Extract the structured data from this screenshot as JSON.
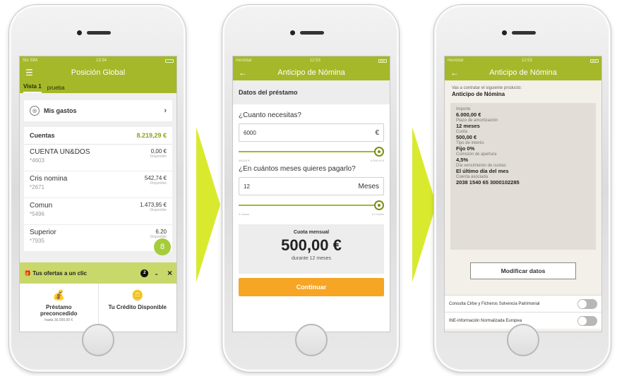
{
  "phone1": {
    "status": {
      "carrier": "Sin SIM",
      "time": "13:34"
    },
    "nav": {
      "title": "Posición Global",
      "menu_icon": "hamburger-icon"
    },
    "tabs": [
      "Vista 1",
      "prueba"
    ],
    "gastos": {
      "label": "Mis gastos"
    },
    "cuentas": {
      "title": "Cuentas",
      "total": "8.219,29 €",
      "rows": [
        {
          "name": "CUENTA UN&DOS",
          "number": "*4603",
          "amount": "0,00 €",
          "status": "Disponible"
        },
        {
          "name": "Cris nomina",
          "number": "*2671",
          "amount": "542,74 €",
          "status": "Disponible"
        },
        {
          "name": "Comun",
          "number": "*5496",
          "amount": "1.473,95 €",
          "status": "Disponible"
        },
        {
          "name": "Superior",
          "number": "*7935",
          "amount": "6.20",
          "status": "Disponible"
        }
      ]
    },
    "ofertas": {
      "label": "Tus ofertas a un clic",
      "count": "2"
    },
    "products": [
      {
        "label": "Préstamo preconcedido",
        "sub": "hasta 30.000,00 €"
      },
      {
        "label": "Tu Crédito Disponible",
        "sub": ""
      }
    ]
  },
  "phone2": {
    "status": {
      "carrier": "movistar",
      "time": "12:53"
    },
    "nav": {
      "title": "Anticipo de Nómina"
    },
    "section": "Datos del préstamo",
    "amount_question": "¿Cuanto necesitas?",
    "amount_value": "6000",
    "amount_unit": "€",
    "amount_range": {
      "min": "450,00 €",
      "max": "6.000,00 €"
    },
    "amount_level": 1.0,
    "months_question": "¿En cuántos meses quieres pagarlo?",
    "months_value": "12",
    "months_unit": "Meses",
    "months_range": {
      "min": "3 meses",
      "max": "12 meses"
    },
    "months_level": 1.0,
    "cuota": {
      "label": "Cuota mensual",
      "value": "500,00 €",
      "duration": "durante 12 meses"
    },
    "cta": "Continuar"
  },
  "phone3": {
    "status": {
      "carrier": "movistar",
      "time": "12:53"
    },
    "nav": {
      "title": "Anticipo de Nómina"
    },
    "intro": "Vas a contratar el siguiente producto:",
    "product": "Anticipo de Nómina",
    "details": [
      {
        "k": "Importe",
        "v": "6.000,00 €"
      },
      {
        "k": "Plazo de amortización",
        "v": "12 meses"
      },
      {
        "k": "Cuota",
        "v": "500,00 €"
      },
      {
        "k": "Tipo de interés",
        "v": "Fijo 0%"
      },
      {
        "k": "Comisión de apertura",
        "v": "4,5%"
      },
      {
        "k": "Día vencimiento de cuotas",
        "v": "El último día del mes"
      },
      {
        "k": "Cuenta asociada",
        "v": "2038 1540 65 3000102285"
      }
    ],
    "modify": "Modificar datos",
    "toggles": [
      {
        "label": "Consulta Cirbe y Ficheros Solvencia Patrimonial",
        "on": false
      },
      {
        "label": "INE-Información Normalizada Europea",
        "on": false
      }
    ]
  },
  "colors": {
    "brand": "#a5b82a",
    "accent": "#f6a524",
    "arrow": "#d9ea2e"
  }
}
